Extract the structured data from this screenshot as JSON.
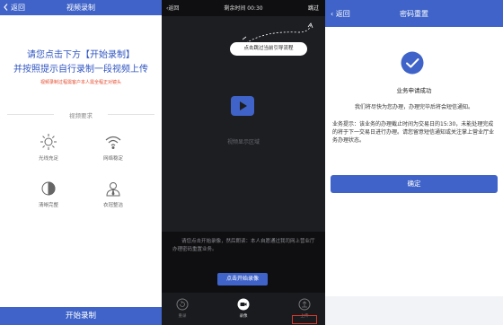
{
  "screen1": {
    "back_label": "返回",
    "title": "视频录制",
    "heading_line1": "请您点击下方【开始录制】",
    "heading_line2": "并按照提示自行录制一段视频上传",
    "warning": "视频录制过程需客户本人需全程正对镜头",
    "requirements_title": "视频要求",
    "features": [
      {
        "label": "光线充足",
        "icon": "sun-icon"
      },
      {
        "label": "网络稳定",
        "icon": "wifi-icon"
      },
      {
        "label": "清晰完整",
        "icon": "contrast-icon"
      },
      {
        "label": "衣冠整洁",
        "icon": "person-icon"
      }
    ],
    "start_label": "开始录制"
  },
  "screen2": {
    "back_label": "返回",
    "remaining": "剩余时间 00:30",
    "skip_label": "跳过",
    "tooltip": "点击跳过当前引导流程",
    "video_label": "视频显示区域",
    "instruction": "请您点击开始录像，然后朗读：本人自愿通过我司网上营业厅办理密码重置业务。",
    "record_button": "点击开始录像",
    "bottom": {
      "redo": "重录",
      "record": "录像",
      "upload": "上传"
    }
  },
  "screen3": {
    "back_label": "返回",
    "title": "密码重置",
    "success": "业务申请成功",
    "message": "我们将尽快为您办理，办理完毕后将会短信通知。",
    "tip": "业务提示：该业务的办理截止时间为交易日的15:30，未能处理完成的将于下一交易日进行办理。请您留意短信通知或关注掌上营业厅业务办理状态。",
    "confirm_label": "确定"
  },
  "colors": {
    "primary": "#3f63c8",
    "warning": "#e5492b",
    "dark_bg": "#0f0f11"
  }
}
